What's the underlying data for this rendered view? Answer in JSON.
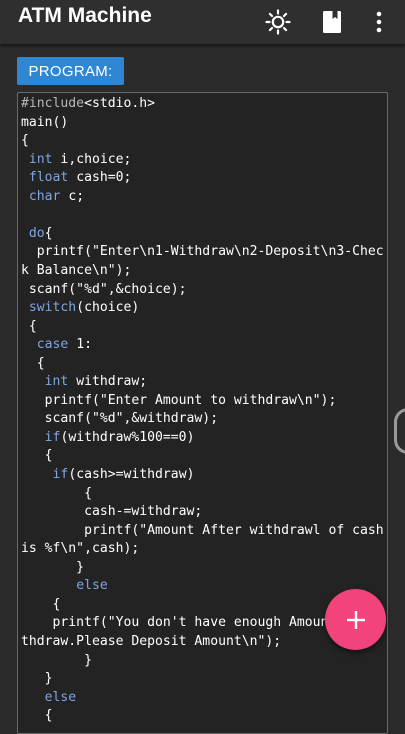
{
  "app": {
    "title": "ATM Machine",
    "icons": [
      "brightness-icon",
      "bookmark-icon",
      "more-vert-icon"
    ]
  },
  "program_button": {
    "label": "PROGRAM:"
  },
  "code": {
    "lines": [
      [
        [
          "#include",
          "pp"
        ],
        [
          "<stdio.h>",
          ""
        ]
      ],
      [
        [
          "main()",
          ""
        ]
      ],
      [
        [
          "{",
          ""
        ]
      ],
      [
        [
          " ",
          ""
        ],
        [
          "int",
          "kw"
        ],
        [
          " i,choice;",
          ""
        ]
      ],
      [
        [
          " ",
          ""
        ],
        [
          "float",
          "kw"
        ],
        [
          " cash=0;",
          ""
        ]
      ],
      [
        [
          " ",
          ""
        ],
        [
          "char",
          "kw"
        ],
        [
          " c;",
          ""
        ]
      ],
      [
        [
          "",
          ""
        ]
      ],
      [
        [
          " ",
          ""
        ],
        [
          "do",
          "kw"
        ],
        [
          "{",
          ""
        ]
      ],
      [
        [
          "  printf(\"Enter\\n1-Withdraw\\n2-Deposit\\n3-Chec",
          ""
        ]
      ],
      [
        [
          "k Balance\\n\");",
          ""
        ]
      ],
      [
        [
          " scanf(\"%d\",&choice);",
          ""
        ]
      ],
      [
        [
          " ",
          ""
        ],
        [
          "switch",
          "kw"
        ],
        [
          "(choice)",
          ""
        ]
      ],
      [
        [
          " {",
          ""
        ]
      ],
      [
        [
          "  ",
          ""
        ],
        [
          "case",
          "kw"
        ],
        [
          " 1:",
          ""
        ]
      ],
      [
        [
          "  {",
          ""
        ]
      ],
      [
        [
          "   ",
          ""
        ],
        [
          "int",
          "kw"
        ],
        [
          " withdraw;",
          ""
        ]
      ],
      [
        [
          "   printf(\"Enter Amount to withdraw\\n\");",
          ""
        ]
      ],
      [
        [
          "   scanf(\"%d\",&withdraw);",
          ""
        ]
      ],
      [
        [
          "   ",
          ""
        ],
        [
          "if",
          "kw"
        ],
        [
          "(withdraw%100==0)",
          ""
        ]
      ],
      [
        [
          "   {",
          ""
        ]
      ],
      [
        [
          "    ",
          ""
        ],
        [
          "if",
          "kw"
        ],
        [
          "(cash>=withdraw)",
          ""
        ]
      ],
      [
        [
          "        {",
          ""
        ]
      ],
      [
        [
          "        cash-=withdraw;",
          ""
        ]
      ],
      [
        [
          "        printf(\"Amount After withdrawl of cash",
          ""
        ]
      ],
      [
        [
          "is %f\\n\",cash);",
          ""
        ]
      ],
      [
        [
          "       }",
          ""
        ]
      ],
      [
        [
          "       ",
          ""
        ],
        [
          "else",
          "kw"
        ]
      ],
      [
        [
          "    {",
          ""
        ]
      ],
      [
        [
          "    printf(\"You don't have enough Amount to wi",
          ""
        ]
      ],
      [
        [
          "thdraw.Please Deposit Amount\\n\");",
          ""
        ]
      ],
      [
        [
          "        }",
          ""
        ]
      ],
      [
        [
          "   }",
          ""
        ]
      ],
      [
        [
          "   ",
          ""
        ],
        [
          "else",
          "kw"
        ]
      ],
      [
        [
          "   {",
          ""
        ]
      ]
    ]
  },
  "fab": {
    "icon": "plus-icon",
    "color": "#f0447a"
  },
  "colors": {
    "accent": "#2f86d3",
    "keyword": "#7fa6df",
    "background": "#2b2b2b"
  }
}
